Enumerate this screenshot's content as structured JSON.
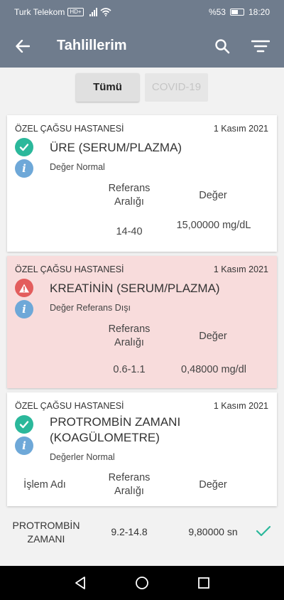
{
  "status_bar": {
    "carrier": "Turk Telekom",
    "network_badge": "HD+",
    "battery": "%53",
    "time": "18:20"
  },
  "app_bar": {
    "title": "Tahlillerim",
    "back_icon": "arrow-left-icon",
    "search_icon": "search-icon",
    "filter_icon": "filter-icon"
  },
  "tabs": [
    {
      "label": "Tümü",
      "active": true
    },
    {
      "label": "COVID-19",
      "active": false
    }
  ],
  "colors": {
    "app_bar": "#6f7c8d",
    "normal_green": "#2bb89b",
    "alert_red": "#e35d5d",
    "alert_bg": "#f8dcdc",
    "info_blue": "#6ea8d8"
  },
  "results": [
    {
      "hospital": "ÖZEL ÇAĞSU HASTANESİ",
      "date": "1 Kasım 2021",
      "test_name": "ÜRE (SERUM/PLAZMA)",
      "status": "Değer Normal",
      "ref_label": "Referans Aralığı",
      "value_label": "Değer",
      "ref_range": "14-40",
      "value": "15,00000 mg/dL"
    },
    {
      "hospital": "ÖZEL ÇAĞSU HASTANESİ",
      "date": "1 Kasım 2021",
      "test_name": "KREATİNİN (SERUM/PLAZMA)",
      "status": "Değer Referans Dışı",
      "ref_label": "Referans Aralığı",
      "value_label": "Değer",
      "ref_range": "0.6-1.1",
      "value": "0,48000 mg/dl"
    },
    {
      "hospital": "ÖZEL ÇAĞSU HASTANESİ",
      "date": "1 Kasım 2021",
      "test_name": "PROTROMBİN ZAMANI (KOAGÜLOMETRE)",
      "status": "Değerler Normal",
      "proc_label": "İşlem Adı",
      "ref_label": "Referans Aralığı",
      "value_label": "Değer"
    }
  ],
  "sub_results": [
    {
      "name": "PROTROMBİN ZAMANI",
      "ref_range": "9.2-14.8",
      "value": "9,80000 sn"
    }
  ]
}
